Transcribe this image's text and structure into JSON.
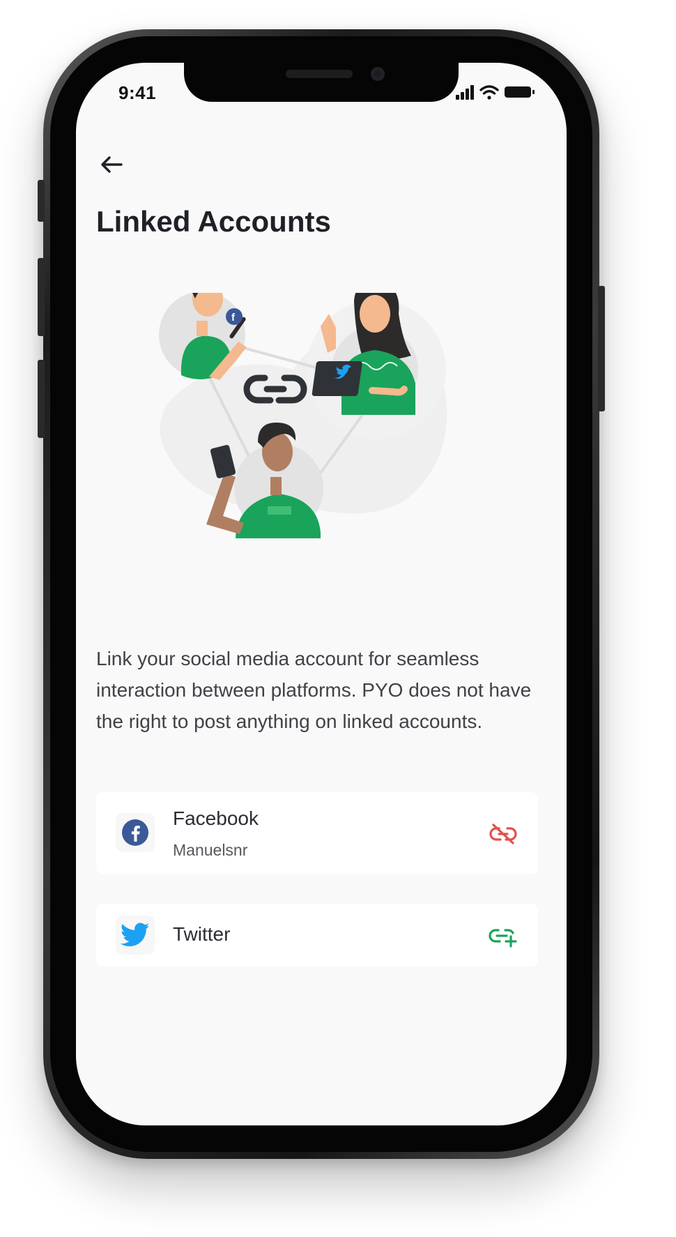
{
  "status_bar": {
    "time": "9:41"
  },
  "page": {
    "title": "Linked Accounts"
  },
  "description": "Link your social media account for seamless interaction between platforms. PYO does not have the right to post anything on linked accounts.",
  "accounts": [
    {
      "platform": "Facebook",
      "username": "Manuelsnr",
      "icon": "facebook-icon",
      "action": "unlink",
      "action_icon": "unlink-icon",
      "action_color": "#e2504c",
      "brand_color": "#3b5998"
    },
    {
      "platform": "Twitter",
      "username": "",
      "icon": "twitter-icon",
      "action": "link",
      "action_icon": "link-add-icon",
      "action_color": "#1aa35a",
      "brand_color": "#1da1f2"
    }
  ],
  "colors": {
    "accent_green": "#1aa35a",
    "background": "#f9f9f9",
    "card": "#ffffff"
  }
}
